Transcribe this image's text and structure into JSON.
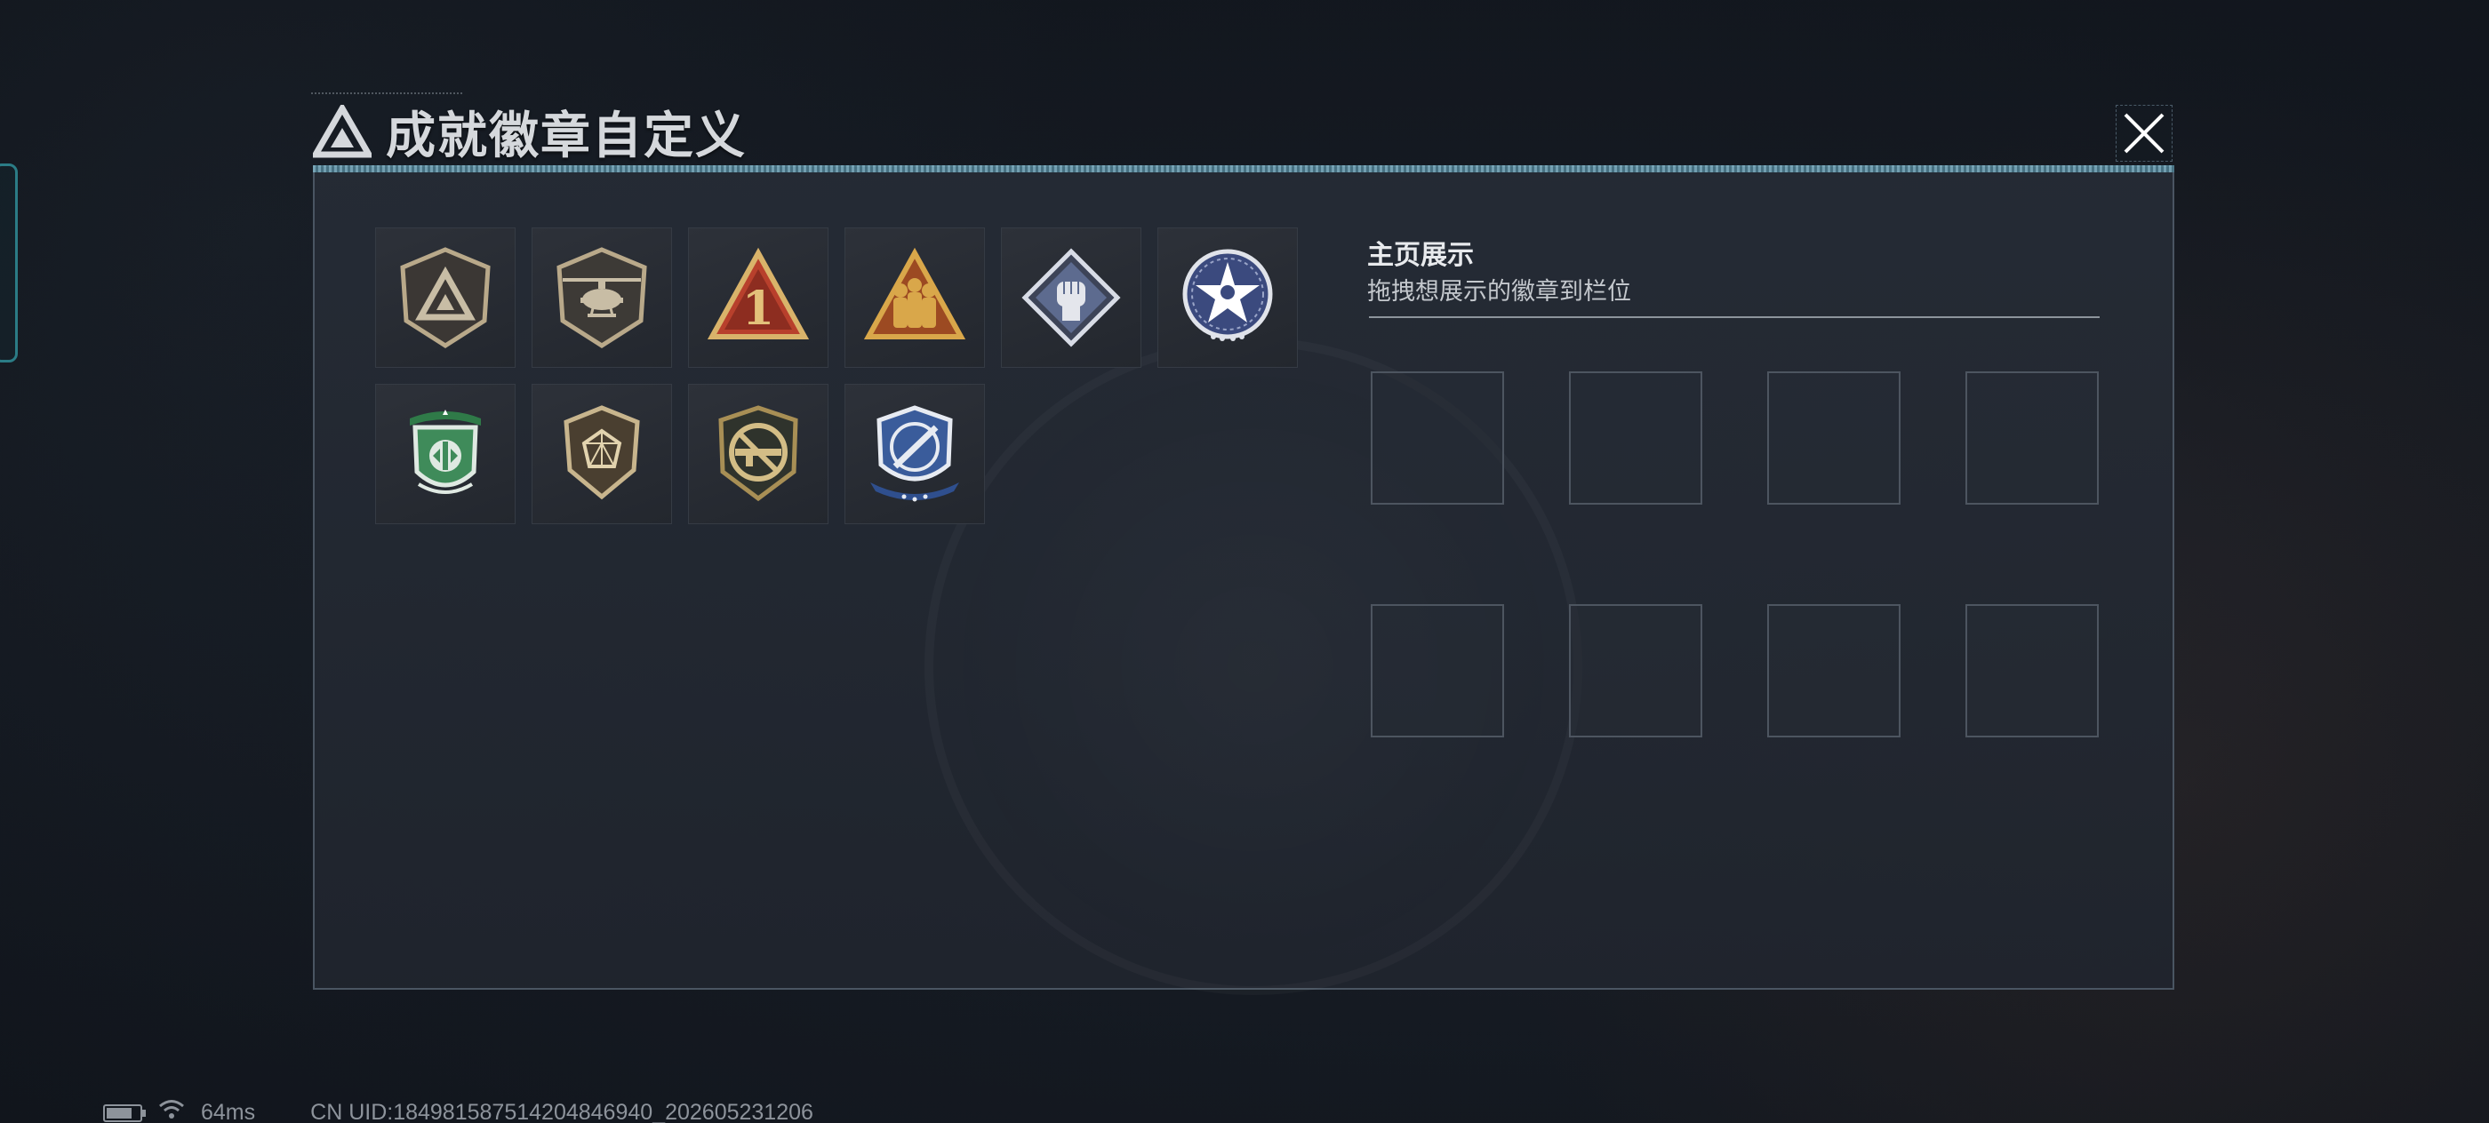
{
  "window": {
    "title": "成就徽章自定义"
  },
  "badges": [
    {
      "name": "triangle-emblem-badge",
      "color": "#b9a98a"
    },
    {
      "name": "helicopter-badge",
      "color": "#b9a98a"
    },
    {
      "name": "number-one-badge",
      "color": "#c44a32"
    },
    {
      "name": "squad-soldiers-badge",
      "color": "#c7902f"
    },
    {
      "name": "fist-badge",
      "color": "#6f7fa6"
    },
    {
      "name": "star-wreath-badge",
      "color": "#5a6aa0"
    },
    {
      "name": "green-winged-shield-badge",
      "color": "#3f8b5a"
    },
    {
      "name": "gem-shield-badge",
      "color": "#b9a98a"
    },
    {
      "name": "rifle-prohibited-badge",
      "color": "#a88f55"
    },
    {
      "name": "blue-missile-shield-badge",
      "color": "#3a5c9b"
    }
  ],
  "showcase": {
    "title": "主页展示",
    "hint": "拖拽想展示的徽章到栏位",
    "slot_count": 8
  },
  "footer": {
    "ping": "64ms",
    "uid": "CN UID:18498158751420484694​0_202605231206"
  },
  "colors": {
    "panel_border": "#4a5562",
    "accent_line": "#7fb3c6",
    "side_tab": "#2b7c86"
  }
}
